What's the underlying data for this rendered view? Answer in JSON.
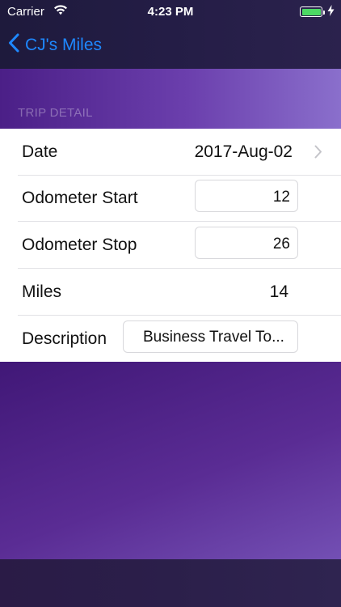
{
  "status_bar": {
    "carrier": "Carrier",
    "time": "4:23 PM",
    "battery_level": 1.0,
    "battery_color": "#4cd964",
    "icons": [
      "wifi-icon",
      "battery-icon",
      "charging-bolt-icon"
    ]
  },
  "nav": {
    "back_label": "CJ's Miles",
    "back_icon": "chevron-left-icon",
    "accent_color": "#1e88ff"
  },
  "section": {
    "title": "TRIP DETAIL"
  },
  "rows": {
    "date": {
      "label": "Date",
      "value": "2017-Aug-02",
      "icon": "chevron-right-icon"
    },
    "odometer_start": {
      "label": "Odometer Start",
      "value": "12"
    },
    "odometer_stop": {
      "label": "Odometer Stop",
      "value": "26"
    },
    "miles": {
      "label": "Miles",
      "value": "14"
    },
    "description": {
      "label": "Description",
      "value": "Business Travel To..."
    }
  }
}
